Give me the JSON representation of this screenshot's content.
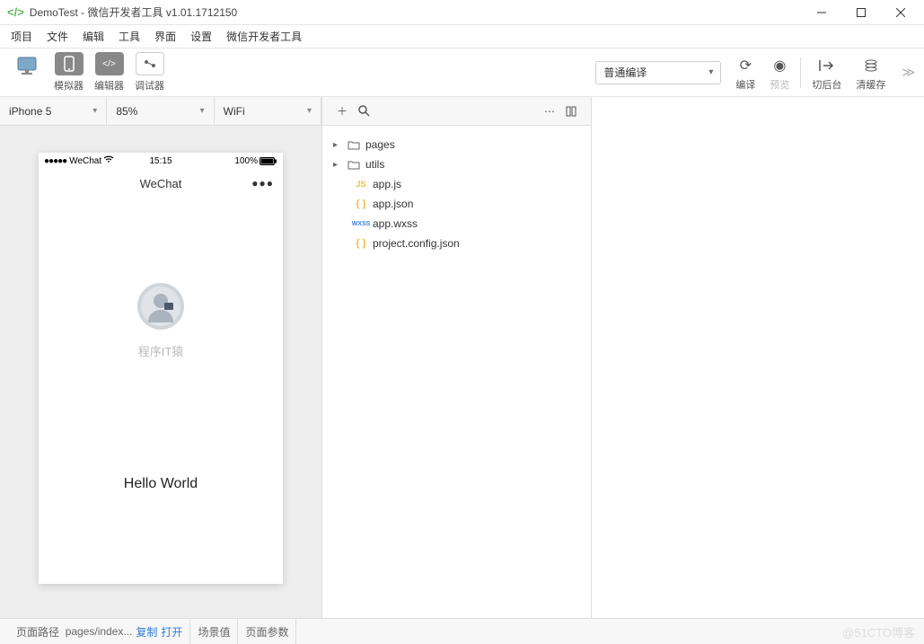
{
  "window": {
    "title": "DemoTest - 微信开发者工具 v1.01.1712150"
  },
  "menubar": {
    "items": [
      "项目",
      "文件",
      "编辑",
      "工具",
      "界面",
      "设置",
      "微信开发者工具"
    ]
  },
  "toolbar": {
    "simulator": "模拟器",
    "editor": "编辑器",
    "debugger": "调试器",
    "compile_select": "普通编译",
    "compile": "编译",
    "preview": "预览",
    "background": "切后台",
    "clear_cache": "清缓存"
  },
  "simulator": {
    "device": "iPhone 5",
    "zoom": "85%",
    "network": "WiFi",
    "status": {
      "carrier": "WeChat",
      "time": "15:15",
      "battery": "100%",
      "signal": "●●●●●"
    },
    "nav_title": "WeChat",
    "nickname": "程序IT猿",
    "hello": "Hello World"
  },
  "explorer": {
    "folders": [
      {
        "name": "pages"
      },
      {
        "name": "utils"
      }
    ],
    "files": [
      {
        "name": "app.js",
        "type": "js"
      },
      {
        "name": "app.json",
        "type": "json"
      },
      {
        "name": "app.wxss",
        "type": "wxss"
      },
      {
        "name": "project.config.json",
        "type": "json"
      }
    ]
  },
  "footer": {
    "page_path_label": "页面路径",
    "page_path": "pages/index...",
    "copy": "复制",
    "open": "打开",
    "scene_value": "场景值",
    "page_params": "页面参数",
    "watermark": "@51CTO博客"
  }
}
